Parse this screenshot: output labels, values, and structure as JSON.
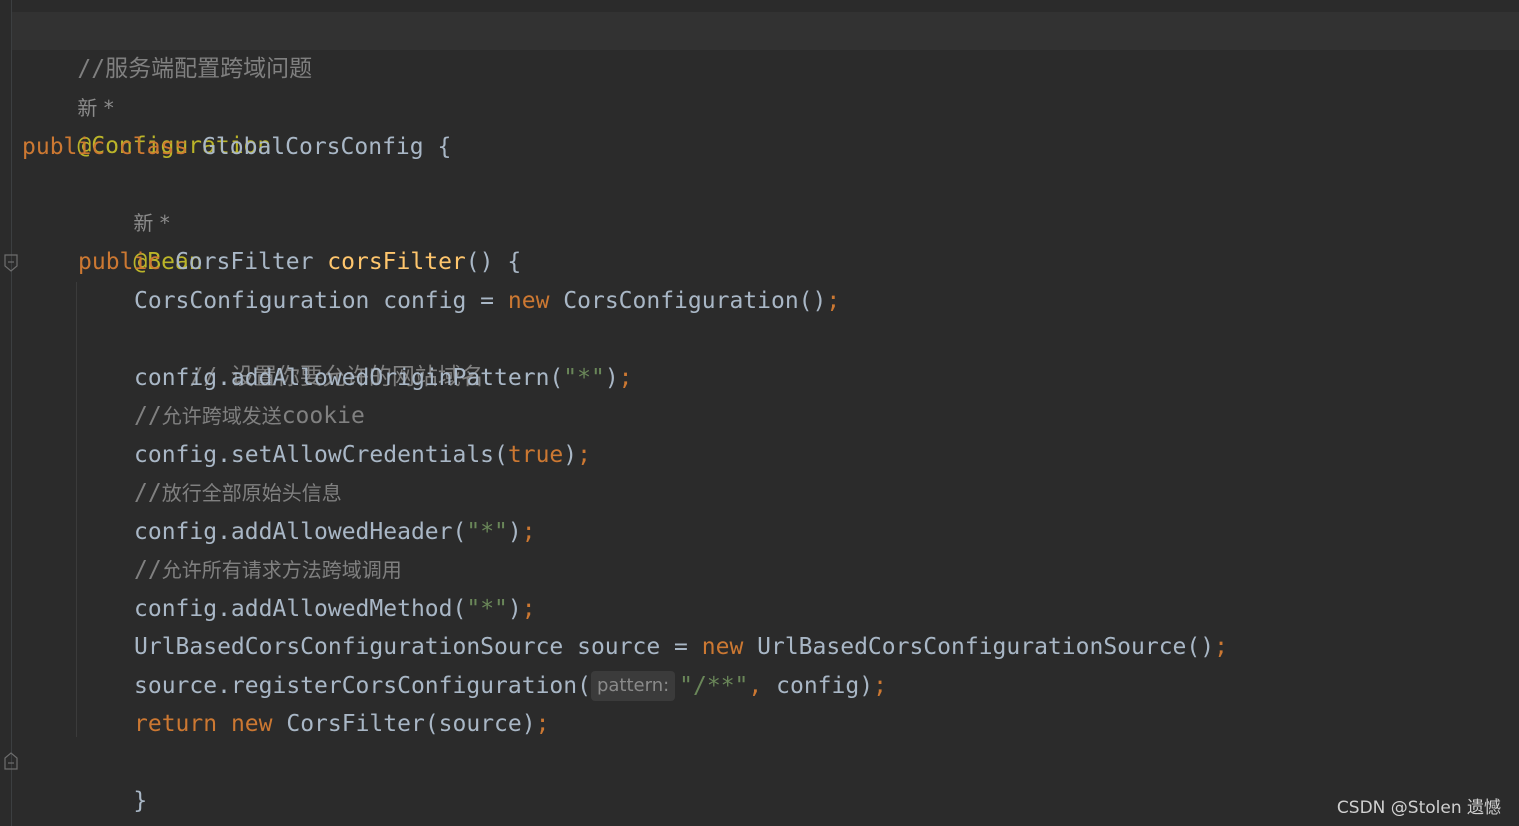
{
  "editor": {
    "comment_header": "//服务端配置跨域问题",
    "author_mark": "新 *",
    "annotation_configuration": "@Configuration",
    "kw_public": "public",
    "kw_class": "class",
    "class_name": "GlobalCorsConfig",
    "open_brace": " {",
    "annotation_bean": "@Bean",
    "return_type": "CorsFilter",
    "method_name": "corsFilter",
    "method_parens": "() {",
    "line_config": {
      "type": "CorsConfiguration",
      "var": " config = ",
      "kw_new": "new",
      "ctor": " CorsConfiguration()",
      "semi": ";"
    },
    "comment_1": "// 设置你要允许的网站域名",
    "call_1": {
      "prefix": "config.addAllowedOriginPattern(",
      "arg": "\"*\"",
      "suffix": ")",
      "semi": ";"
    },
    "comment_2_prefix": "//",
    "comment_2_cn": "允许跨域发送",
    "comment_2_en": "cookie",
    "call_2": {
      "prefix": "config.setAllowCredentials(",
      "arg": "true",
      "suffix": ")",
      "semi": ";"
    },
    "comment_3_prefix": "//",
    "comment_3_cn": "放行全部原始头信息",
    "call_3": {
      "prefix": "config.addAllowedHeader(",
      "arg": "\"*\"",
      "suffix": ")",
      "semi": ";"
    },
    "comment_4_prefix": "//",
    "comment_4_cn": "允许所有请求方法跨域调用",
    "call_4": {
      "prefix": "config.addAllowedMethod(",
      "arg": "\"*\"",
      "suffix": ")",
      "semi": ";"
    },
    "line_source": {
      "type": "UrlBasedCorsConfigurationSource",
      "var": " source = ",
      "kw_new": "new",
      "ctor": " UrlBasedCorsConfigurationSource()",
      "semi": ";"
    },
    "call_5": {
      "prefix": "source.registerCorsConfiguration(",
      "hint": "pattern:",
      "arg": "\"/**\"",
      "comma": ",",
      "rest": " config)",
      "semi": ";"
    },
    "line_return": {
      "kw_return": "return",
      "kw_new": "new",
      "rest": " CorsFilter(source)",
      "semi": ";"
    },
    "close_method": "}",
    "close_class": "}"
  },
  "watermark": "CSDN @Stolen 遗憾",
  "colors": {
    "background": "#2b2b2b",
    "keyword": "#cc7832",
    "annotation": "#bbb529",
    "method_decl": "#ffc66d",
    "string": "#6a8759",
    "comment": "#808080",
    "text": "#a9b7c6"
  }
}
